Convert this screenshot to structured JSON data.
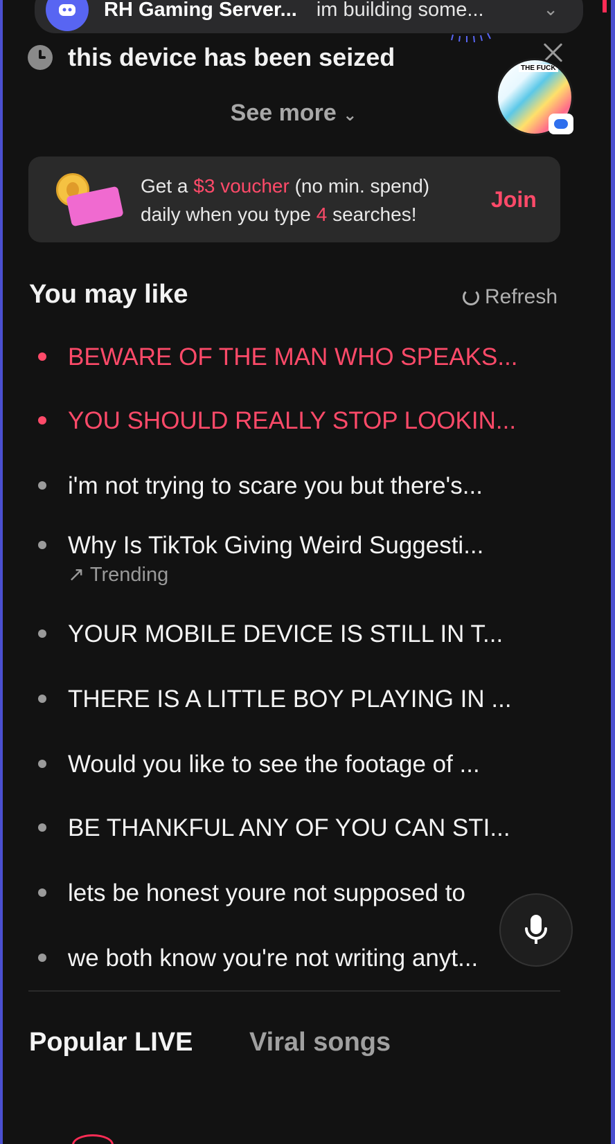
{
  "notification": {
    "title": "RH Gaming Server...",
    "message": "im building some..."
  },
  "history": {
    "text": "this device has been seized",
    "see_more": "See more"
  },
  "voucher": {
    "line1_pre": "Get a ",
    "amount": "$3 voucher",
    "line1_post": " (no min. spend)",
    "line2_pre": "daily when you type ",
    "count": "4",
    "line2_post": " searches!",
    "join_label": "Join"
  },
  "avatar_banner_text": "THE FUCK",
  "you_may_like": {
    "title": "You may like",
    "refresh_label": "Refresh",
    "items": [
      {
        "text": "BEWARE OF THE MAN WHO SPEAKS...",
        "hot": true
      },
      {
        "text": "YOU SHOULD REALLY STOP LOOKIN...",
        "hot": true
      },
      {
        "text": "i'm not trying to scare you but there's...",
        "hot": false
      },
      {
        "text": "Why Is TikTok Giving Weird Suggesti...",
        "hot": false,
        "tag": "Trending"
      },
      {
        "text": "YOUR MOBILE DEVICE IS STILL IN T...",
        "hot": false
      },
      {
        "text": "THERE IS A LITTLE BOY PLAYING IN ...",
        "hot": false
      },
      {
        "text": "Would you like to see the footage of ...",
        "hot": false
      },
      {
        "text": "BE THANKFUL ANY OF YOU CAN STI...",
        "hot": false
      },
      {
        "text": "lets be honest youre not supposed to",
        "hot": false
      },
      {
        "text": "we both know you're not writing anyt...",
        "hot": false
      }
    ]
  },
  "tabs": {
    "popular_live": "Popular LIVE",
    "viral_songs": "Viral songs"
  },
  "colors": {
    "accent": "#fe4a69",
    "background": "#121212",
    "card": "#2a2a2a",
    "discord": "#5865f2"
  }
}
